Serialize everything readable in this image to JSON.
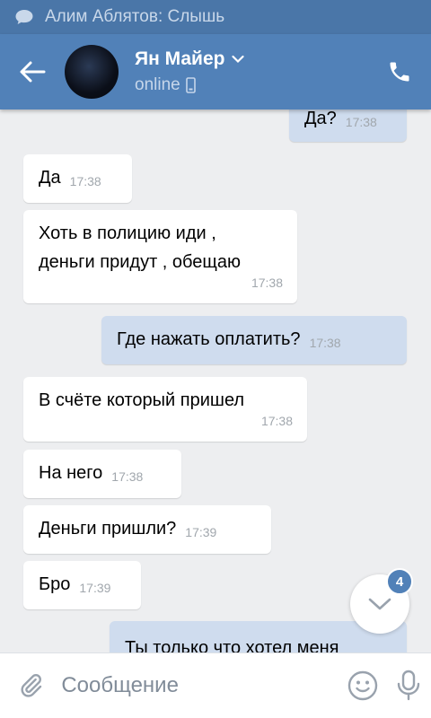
{
  "notification": {
    "text": "Алим Аблятов: Слышь",
    "icon": "chat-bubble-icon"
  },
  "header": {
    "name": "Ян Майер",
    "status": "online",
    "icons": [
      "back-arrow-icon",
      "chevron-down-icon",
      "mobile-phone-icon",
      "call-icon"
    ]
  },
  "messages": [
    {
      "dir": "out",
      "text": "Да?",
      "time": "17:38"
    },
    {
      "dir": "in",
      "text": "Да",
      "time": "17:38"
    },
    {
      "dir": "in",
      "line1": "Хоть в полицию иди ,",
      "line2": "деньги придут , обещаю",
      "time": "17:38"
    },
    {
      "dir": "out",
      "text": "Где нажать оплатить?",
      "time": "17:38"
    },
    {
      "dir": "in",
      "text": "В счёте который пришел",
      "time": "17:38"
    },
    {
      "dir": "in",
      "text": "На него",
      "time": "17:38"
    },
    {
      "dir": "in",
      "text": "Деньги пришли?",
      "time": "17:39"
    },
    {
      "dir": "in",
      "text": "Бро",
      "time": "17:39"
    },
    {
      "dir": "out",
      "text": "Ты только что хотел меня"
    }
  ],
  "scroll_button": {
    "badge": "4",
    "icon": "chevron-down-icon"
  },
  "composer": {
    "placeholder": "Сообщение",
    "icons": [
      "paperclip-icon",
      "smile-icon",
      "microphone-icon"
    ]
  },
  "colors": {
    "header": "#5181b8",
    "outgoing": "#cfdcee",
    "accent": "#5181b8"
  }
}
